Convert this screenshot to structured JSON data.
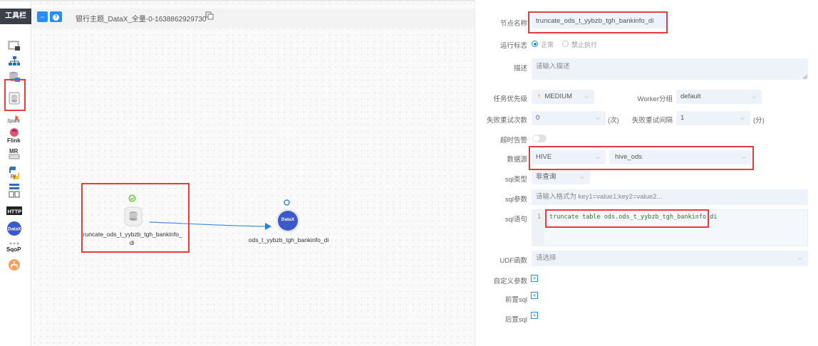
{
  "toolbar": {
    "title": "工具栏",
    "tools": [
      {
        "name": "shell-task",
        "icon": "terminal-icon"
      },
      {
        "name": "sub-process-task",
        "icon": "sitemap-icon"
      },
      {
        "name": "procedure-task",
        "icon": "database-stack-icon"
      },
      {
        "name": "sql-task",
        "icon": "sql-db-icon",
        "selected": true
      },
      {
        "name": "spark-task",
        "icon": "spark-icon"
      },
      {
        "name": "flink-task",
        "icon": "flink-icon",
        "label": "Flink"
      },
      {
        "name": "mr-task",
        "icon": "mr-icon",
        "label": "MR"
      },
      {
        "name": "python-task",
        "icon": "python-icon",
        "label": "py"
      },
      {
        "name": "dependent-task",
        "icon": "dependent-icon"
      },
      {
        "name": "http-task",
        "icon": "http-icon",
        "label": "HTTP"
      },
      {
        "name": "datax-task",
        "icon": "datax-icon",
        "label": "DataX"
      },
      {
        "name": "sqoop-task",
        "icon": "sqoop-icon",
        "label": "SqoP"
      },
      {
        "name": "conditions-task",
        "icon": "conditions-icon"
      }
    ]
  },
  "canvas": {
    "process_name": "银行主题_DataX_全量-0-1638862929730",
    "btn_full": "⇔",
    "btn_info": "?",
    "nodes": [
      {
        "id": "sql",
        "label_line1": "truncate_ods_t_yybzb_tgh_bankinfo_",
        "label_line2": "di",
        "status": "success"
      },
      {
        "id": "datax",
        "label_line1": "ods_t_yybzb_tgh_bankinfo_di",
        "icon_text": "DataX",
        "status": "info"
      }
    ]
  },
  "form": {
    "node_name_label": "节点名称",
    "node_name_value": "truncate_ods_t_yybzb_tgh_bankinfo_di",
    "run_flag_label": "运行标志",
    "run_flag_normal": "正常",
    "run_flag_forbidden": "禁止执行",
    "desc_label": "描述",
    "desc_placeholder": "请输入描述",
    "priority_label": "任务优先级",
    "priority_value": "MEDIUM",
    "worker_label": "Worker分组",
    "worker_value": "default",
    "retry_times_label": "失败重试次数",
    "retry_times_value": "0",
    "retry_times_unit": "(次)",
    "retry_interval_label": "失败重试间隔",
    "retry_interval_value": "1",
    "retry_interval_unit": "(分)",
    "timeout_label": "超时告警",
    "datasource_label": "数据源",
    "datasource_type": "HIVE",
    "datasource_name": "hive_ods",
    "sql_type_label": "sql类型",
    "sql_type_value": "非查询",
    "sql_params_label": "sql参数",
    "sql_params_placeholder": "请输入格式为 key1=value1;key2=value2...",
    "sql_stmt_label": "sql语句",
    "sql_line_no": "1",
    "sql_kw1": "truncate",
    "sql_kw2": "table",
    "sql_rest": "ods.ods_t_yybzb_tgh_bankinfo_di",
    "udf_label": "UDF函数",
    "udf_placeholder": "请选择",
    "custom_params_label": "自定义参数",
    "pre_sql_label": "前置sql",
    "post_sql_label": "后置sql"
  },
  "colors": {
    "accent": "#2d8cf0",
    "highlight": "#e83b3b",
    "success": "#52c41a",
    "priority_arrow": "#ff6a00"
  }
}
